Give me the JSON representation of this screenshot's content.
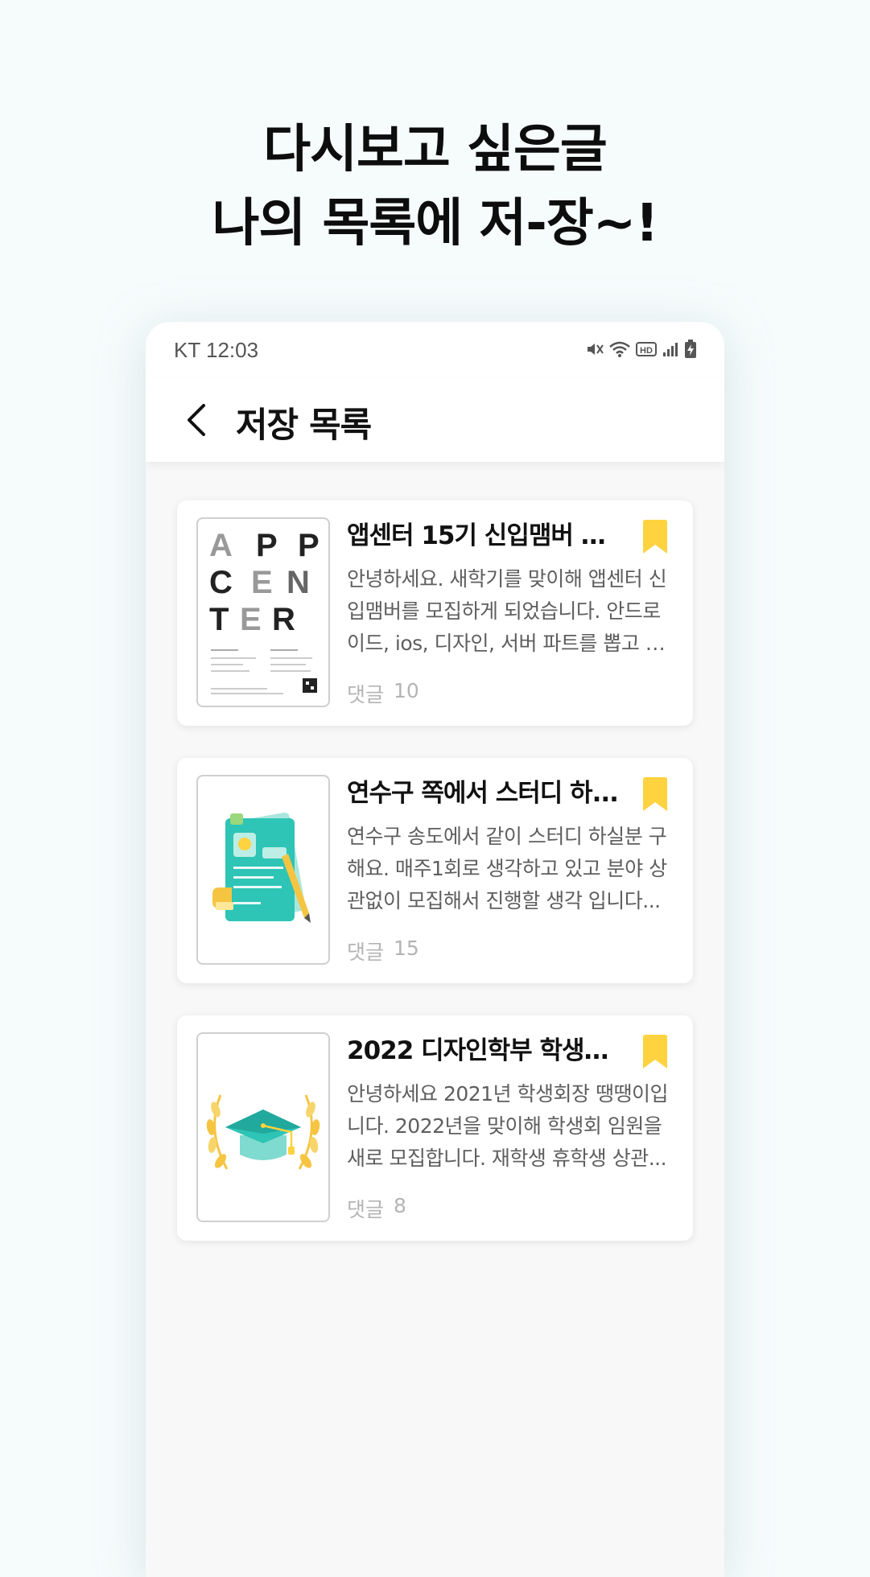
{
  "headline": {
    "line1": "다시보고 싶은글",
    "line2": "나의 목록에 저-장~!"
  },
  "status_bar": {
    "time": "KT 12:03",
    "icons": [
      "mute-icon",
      "wifi-icon",
      "hd-icon",
      "signal-icon",
      "battery-charging-icon"
    ]
  },
  "header": {
    "back_icon": "chevron-left-icon",
    "title": "저장 목록"
  },
  "colors": {
    "bookmark": "#ffd23f",
    "accent_teal": "#2ec4b6",
    "background": "#f6fcfc"
  },
  "posts": [
    {
      "title": "앱센터 15기 신입맴버 모...",
      "body_lines": [
        "안녕하세요. 새학기를 맞이해 앱센터 신",
        "입맴버를 모집하게 되었습니다. 안드로",
        "이드, ios, 디자인, 서버 파트를 뽑고 있..."
      ],
      "comments_label": "댓글",
      "comments_count": "10",
      "thumbnail": "app-center-poster",
      "thumbnail_letters": [
        "A",
        "P",
        "P",
        "C",
        "E",
        "N",
        "T",
        "E",
        "R"
      ],
      "bookmarked": true
    },
    {
      "title": "연수구 쪽에서 스터디 하...",
      "body_lines": [
        "연수구 송도에서 같이 스터디 하실분 구",
        "해요. 매주1회로 생각하고 있고 분야 상",
        "관없이 모집해서 진행할 생각 입니다..."
      ],
      "comments_label": "댓글",
      "comments_count": "15",
      "thumbnail": "study-document-illustration",
      "bookmarked": true
    },
    {
      "title": "2022 디자인학부 학생회...",
      "body_lines": [
        "안녕하세요 2021년 학생회장 땡땡이입",
        "니다. 2022년을 맞이해 학생회 임원을",
        "새로 모집합니다. 재학생 휴학생 상관..."
      ],
      "comments_label": "댓글",
      "comments_count": "8",
      "thumbnail": "graduation-cap-illustration",
      "bookmarked": true
    }
  ]
}
